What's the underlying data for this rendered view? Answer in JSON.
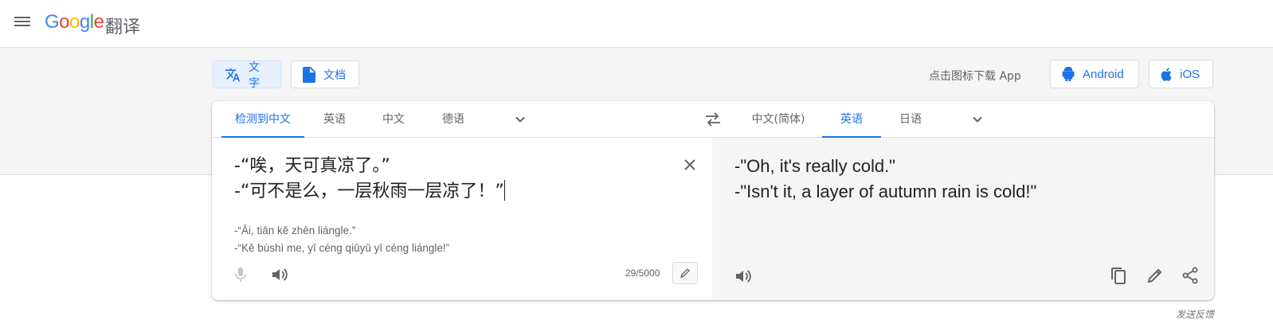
{
  "header": {
    "logo_letters": [
      "G",
      "o",
      "o",
      "g",
      "l",
      "e"
    ],
    "product_name": "翻译"
  },
  "modes": {
    "text_label": "文字",
    "docs_label": "文档"
  },
  "download": {
    "prompt": "点击图标下载 App",
    "android_label": "Android",
    "ios_label": "iOS"
  },
  "source_languages": [
    "检测到中文",
    "英语",
    "中文",
    "德语"
  ],
  "target_languages": [
    "中文(简体)",
    "英语",
    "日语"
  ],
  "source": {
    "line1": "-“唉，天可真凉了。”",
    "line2": "-“可不是么，一层秋雨一层凉了！”",
    "translit_line1": "-“Āi, tiān kě zhēn liángle.”",
    "translit_line2": "-“Kě bùshì me, yī céng qiūyǔ yī céng liángle!”",
    "char_count": "29/5000"
  },
  "target": {
    "line1": "-\"Oh, it's really cold.\"",
    "line2": "-\"Isn't it, a layer of autumn rain is cold!\""
  },
  "feedback_label": "发送反馈",
  "colors": {
    "accent": "#1a73e8",
    "active_bg": "#e8f0fe",
    "band_bg": "#f5f5f5"
  }
}
